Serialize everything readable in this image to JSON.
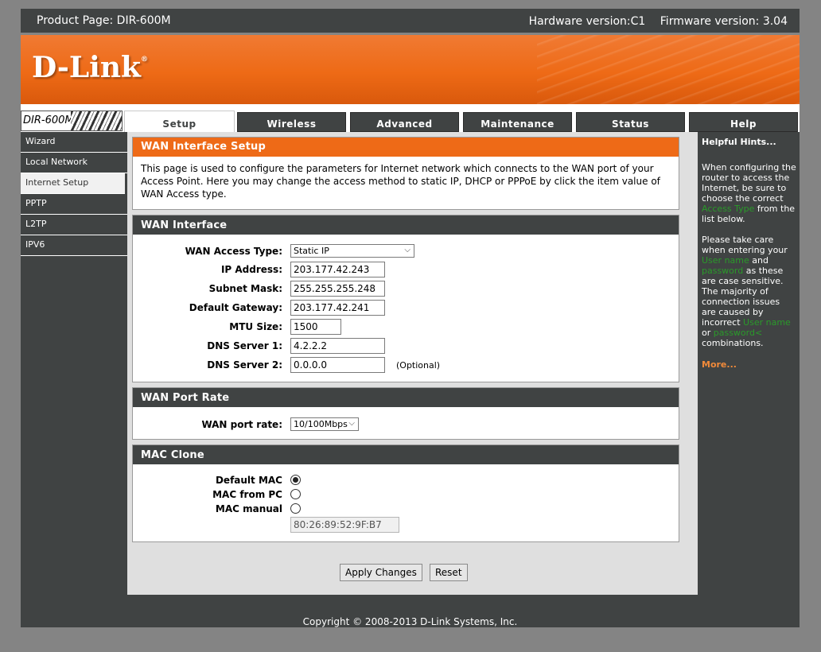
{
  "header": {
    "product_page": "Product Page: DIR-600M",
    "hardware_version": "Hardware version:C1",
    "firmware_version": "Firmware version: 3.04"
  },
  "brand": {
    "logo_text": "D-Link",
    "logo_mark": "®",
    "model": "DIR-600M",
    "accent_color": "#ee6a17",
    "dark_color": "#404343"
  },
  "tabs": [
    {
      "label": "Setup",
      "active": true
    },
    {
      "label": "Wireless"
    },
    {
      "label": "Advanced"
    },
    {
      "label": "Maintenance"
    },
    {
      "label": "Status"
    },
    {
      "label": "Help"
    }
  ],
  "sidebar": {
    "items": [
      {
        "label": "Wizard"
      },
      {
        "label": "Local Network"
      },
      {
        "label": "Internet Setup",
        "active": true
      },
      {
        "label": "PPTP"
      },
      {
        "label": "L2TP"
      },
      {
        "label": "IPV6"
      }
    ]
  },
  "intro": {
    "title": "WAN Interface Setup",
    "text": "This page is used to configure the parameters for Internet network which connects to the WAN port of your Access Point. Here you may change the access method to static IP, DHCP or PPPoE by click the item value of WAN Access type."
  },
  "wan": {
    "title": "WAN Interface",
    "access_type_label": "WAN Access Type:",
    "access_type_value": "Static IP",
    "ip_label": "IP Address:",
    "ip_value": "203.177.42.243",
    "subnet_label": "Subnet Mask:",
    "subnet_value": "255.255.255.248",
    "gateway_label": "Default Gateway:",
    "gateway_value": "203.177.42.241",
    "mtu_label": "MTU Size:",
    "mtu_value": "1500",
    "dns1_label": "DNS Server 1:",
    "dns1_value": "4.2.2.2",
    "dns2_label": "DNS Server 2:",
    "dns2_value": "0.0.0.0",
    "optional_note": "(Optional)"
  },
  "port_rate": {
    "title": "WAN Port Rate",
    "label": "WAN port rate:",
    "value": "10/100Mbps"
  },
  "mac_clone": {
    "title": "MAC Clone",
    "default_label": "Default MAC",
    "from_pc_label": "MAC from PC",
    "manual_label": "MAC manual",
    "selected": "Default MAC",
    "manual_value": "80:26:89:52:9F:B7"
  },
  "actions": {
    "apply_label": "Apply Changes",
    "reset_label": "Reset"
  },
  "hints": {
    "title": "Helpful Hints...",
    "p1_a": "When configuring the router to access the Internet, be sure to choose the correct ",
    "p1_hl": "Access Type",
    "p1_b": " from the list below.",
    "p2_a": "Please take care when entering your ",
    "p2_hl1": "User name",
    "p2_and": " and ",
    "p2_hl2": "password",
    "p2_b": " as these are case sensitive. The majority of connection issues are caused by incorrect ",
    "p2_hl3": "User name",
    "p2_or": " or ",
    "p2_hl4": "password<",
    "p2_c": " combinations.",
    "more": "More..."
  },
  "footer": {
    "copyright": "Copyright © 2008-2013 D-Link Systems, Inc."
  }
}
